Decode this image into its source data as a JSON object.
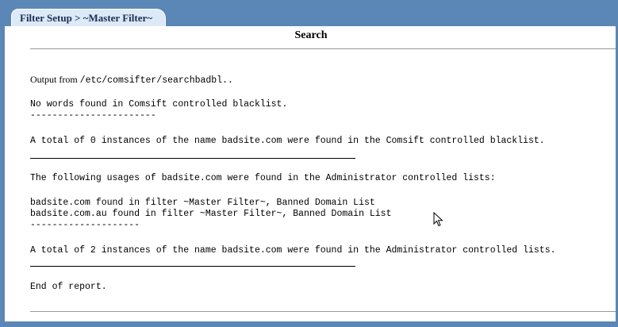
{
  "tab": {
    "label": "Filter Setup > ~Master Filter~"
  },
  "page": {
    "title": "Search"
  },
  "report": {
    "output_prefix": "Output from ",
    "output_path": "/etc/comsifter/searchbadbl..",
    "line_no_words": "No words found in Comsift controlled blacklist.",
    "dashes_1": "-----------------------",
    "line_total_comsift": "A total of 0 instances of the name badsite.com were found in the Comsift controlled blacklist.",
    "line_following": "The following usages of badsite.com were found in the Administrator controlled lists:",
    "line_found_1": "badsite.com found in filter ~Master Filter~, Banned Domain List",
    "line_found_2": "badsite.com.au found in filter ~Master Filter~, Banned Domain List",
    "dashes_2": "--------------------",
    "line_total_admin": "A total of 2 instances of the name badsite.com were found in the Administrator controlled lists.",
    "line_end": "End of report."
  }
}
